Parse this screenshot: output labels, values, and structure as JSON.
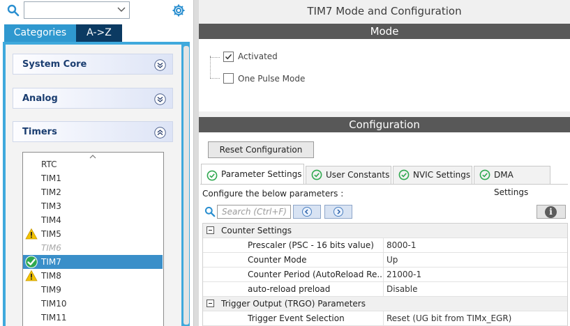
{
  "search": {
    "value": ""
  },
  "tabs": {
    "categories": "Categories",
    "az": "A->Z"
  },
  "categories": [
    {
      "label": "System Core",
      "expanded": false
    },
    {
      "label": "Analog",
      "expanded": false
    },
    {
      "label": "Timers",
      "expanded": true
    }
  ],
  "timers": [
    {
      "label": "RTC",
      "state": "normal"
    },
    {
      "label": "TIM1",
      "state": "normal"
    },
    {
      "label": "TIM2",
      "state": "normal"
    },
    {
      "label": "TIM3",
      "state": "normal"
    },
    {
      "label": "TIM4",
      "state": "normal"
    },
    {
      "label": "TIM5",
      "state": "warning"
    },
    {
      "label": "TIM6",
      "state": "disabled"
    },
    {
      "label": "TIM7",
      "state": "selected-ok"
    },
    {
      "label": "TIM8",
      "state": "warning"
    },
    {
      "label": "TIM9",
      "state": "normal"
    },
    {
      "label": "TIM10",
      "state": "normal"
    },
    {
      "label": "TIM11",
      "state": "normal"
    }
  ],
  "title": "TIM7 Mode and Configuration",
  "mode": {
    "header": "Mode",
    "activated": {
      "label": "Activated",
      "checked": true
    },
    "one_pulse": {
      "label": "One Pulse Mode",
      "checked": false
    }
  },
  "configuration": {
    "header": "Configuration",
    "reset_label": "Reset Configuration",
    "tabs": [
      "Parameter Settings",
      "User Constants",
      "NVIC Settings",
      "DMA Settings"
    ],
    "configure_text": "Configure the below parameters :",
    "search_placeholder": "Search (Ctrl+F)",
    "info_label": "i",
    "groups": [
      {
        "name": "Counter Settings",
        "params": [
          {
            "name": "Prescaler (PSC - 16 bits value)",
            "value": "8000-1"
          },
          {
            "name": "Counter Mode",
            "value": "Up"
          },
          {
            "name": "Counter Period (AutoReload Re...",
            "value": "21000-1"
          },
          {
            "name": "auto-reload preload",
            "value": "Disable"
          }
        ]
      },
      {
        "name": "Trigger Output (TRGO) Parameters",
        "params": [
          {
            "name": "Trigger Event Selection",
            "value": "Reset (UG bit from TIMx_EGR)"
          }
        ]
      }
    ]
  },
  "colors": {
    "accent": "#3fa9dc",
    "tab_dark": "#0b3a62",
    "selection": "#3a8fc9",
    "header_bar": "#585858",
    "warning": "#f2c200",
    "ok": "#2fa84f"
  }
}
